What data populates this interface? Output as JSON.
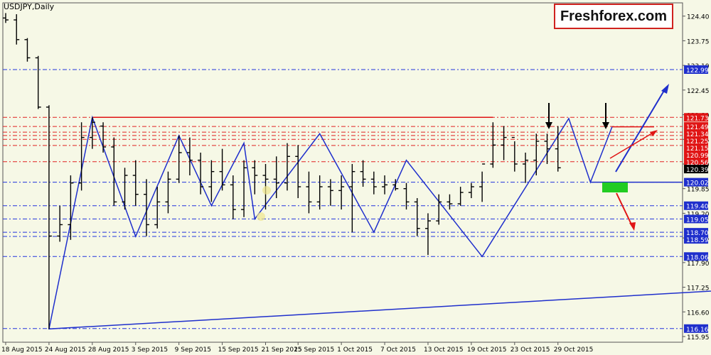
{
  "chart_data": {
    "type": "ohlc",
    "symbol_label": "USDJPY,Daily",
    "watermark_text": "Freshforex.com",
    "ylim": [
      115.8,
      124.75
    ],
    "y_ticks": [
      "124.40",
      "123.75",
      "123.10",
      "122.45",
      "121.80",
      "121.15",
      "120.50",
      "119.85",
      "119.20",
      "118.55",
      "117.90",
      "117.25",
      "116.60",
      "115.95"
    ],
    "x_ticks": [
      "18 Aug 2015",
      "24 Aug 2015",
      "28 Aug 2015",
      "3 Sep 2015",
      "9 Sep 2015",
      "15 Sep 2015",
      "21 Sep 2015",
      "25 Sep 2015",
      "1 Oct 2015",
      "7 Oct 2015",
      "13 Oct 2015",
      "19 Oct 2015",
      "23 Oct 2015",
      "29 Oct 2015"
    ],
    "bars": [
      {
        "o": 124.35,
        "h": 124.48,
        "l": 124.22,
        "c": 124.3
      },
      {
        "o": 124.3,
        "h": 124.45,
        "l": 123.65,
        "c": 123.78
      },
      {
        "o": 123.78,
        "h": 123.82,
        "l": 123.2,
        "c": 123.3
      },
      {
        "o": 123.3,
        "h": 123.35,
        "l": 121.95,
        "c": 122.0
      },
      {
        "o": 122.0,
        "h": 122.05,
        "l": 116.15,
        "c": 118.6
      },
      {
        "o": 118.6,
        "h": 119.4,
        "l": 118.45,
        "c": 118.9
      },
      {
        "o": 118.9,
        "h": 120.2,
        "l": 118.5,
        "c": 120.0
      },
      {
        "o": 120.0,
        "h": 121.6,
        "l": 119.8,
        "c": 121.2
      },
      {
        "o": 121.2,
        "h": 121.73,
        "l": 120.9,
        "c": 121.6
      },
      {
        "o": 121.5,
        "h": 121.6,
        "l": 120.8,
        "c": 120.95
      },
      {
        "o": 120.95,
        "h": 121.2,
        "l": 119.4,
        "c": 119.5
      },
      {
        "o": 119.5,
        "h": 120.4,
        "l": 119.3,
        "c": 120.2
      },
      {
        "o": 120.2,
        "h": 120.6,
        "l": 119.4,
        "c": 119.7
      },
      {
        "o": 119.7,
        "h": 120.1,
        "l": 118.6,
        "c": 118.9
      },
      {
        "o": 118.9,
        "h": 119.9,
        "l": 118.8,
        "c": 119.5
      },
      {
        "o": 119.5,
        "h": 120.3,
        "l": 119.2,
        "c": 120.1
      },
      {
        "o": 120.1,
        "h": 121.25,
        "l": 120.0,
        "c": 120.8
      },
      {
        "o": 120.8,
        "h": 121.2,
        "l": 120.2,
        "c": 120.6
      },
      {
        "o": 120.6,
        "h": 120.8,
        "l": 119.7,
        "c": 119.9
      },
      {
        "o": 119.9,
        "h": 120.6,
        "l": 119.5,
        "c": 120.3
      },
      {
        "o": 120.3,
        "h": 120.9,
        "l": 119.8,
        "c": 119.95
      },
      {
        "o": 119.95,
        "h": 120.2,
        "l": 119.05,
        "c": 119.3
      },
      {
        "o": 119.3,
        "h": 120.6,
        "l": 119.1,
        "c": 120.4
      },
      {
        "o": 120.4,
        "h": 120.6,
        "l": 119.7,
        "c": 120.2
      },
      {
        "o": 120.2,
        "h": 120.5,
        "l": 119.3,
        "c": 120.1
      },
      {
        "o": 120.1,
        "h": 120.7,
        "l": 119.6,
        "c": 120.0
      },
      {
        "o": 120.0,
        "h": 121.05,
        "l": 119.8,
        "c": 120.7
      },
      {
        "o": 120.7,
        "h": 121.0,
        "l": 119.6,
        "c": 119.9
      },
      {
        "o": 119.9,
        "h": 120.3,
        "l": 119.2,
        "c": 119.5
      },
      {
        "o": 119.5,
        "h": 120.2,
        "l": 119.3,
        "c": 119.9
      },
      {
        "o": 119.9,
        "h": 120.1,
        "l": 119.4,
        "c": 119.8
      },
      {
        "o": 119.8,
        "h": 120.2,
        "l": 119.3,
        "c": 119.9
      },
      {
        "o": 119.9,
        "h": 120.5,
        "l": 118.7,
        "c": 120.3
      },
      {
        "o": 120.3,
        "h": 120.6,
        "l": 119.9,
        "c": 120.1
      },
      {
        "o": 120.1,
        "h": 120.3,
        "l": 119.7,
        "c": 119.9
      },
      {
        "o": 119.9,
        "h": 120.2,
        "l": 119.7,
        "c": 119.95
      },
      {
        "o": 119.95,
        "h": 120.1,
        "l": 119.8,
        "c": 119.85
      },
      {
        "o": 119.85,
        "h": 120.0,
        "l": 119.3,
        "c": 119.5
      },
      {
        "o": 119.5,
        "h": 119.6,
        "l": 118.6,
        "c": 118.8
      },
      {
        "o": 118.8,
        "h": 119.2,
        "l": 118.1,
        "c": 119.0
      },
      {
        "o": 119.0,
        "h": 119.7,
        "l": 118.9,
        "c": 119.5
      },
      {
        "o": 119.5,
        "h": 119.7,
        "l": 119.3,
        "c": 119.45
      },
      {
        "o": 119.45,
        "h": 119.9,
        "l": 119.4,
        "c": 119.75
      },
      {
        "o": 119.75,
        "h": 120.0,
        "l": 119.6,
        "c": 119.9
      },
      {
        "o": 119.9,
        "h": 120.3,
        "l": 119.5,
        "c": 120.5
      },
      {
        "o": 120.5,
        "h": 121.6,
        "l": 120.4,
        "c": 121.0
      },
      {
        "o": 121.0,
        "h": 121.5,
        "l": 120.6,
        "c": 121.2
      },
      {
        "o": 121.2,
        "h": 121.1,
        "l": 120.3,
        "c": 120.5
      },
      {
        "o": 120.5,
        "h": 120.8,
        "l": 120.0,
        "c": 120.6
      },
      {
        "o": 120.6,
        "h": 121.3,
        "l": 120.2,
        "c": 121.1
      },
      {
        "o": 121.1,
        "h": 121.3,
        "l": 120.5,
        "c": 120.9
      },
      {
        "o": 120.9,
        "h": 121.5,
        "l": 120.3,
        "c": 120.4
      }
    ],
    "zigzag": [
      [
        120.5,
        118.05
      ],
      [
        4,
        116.15
      ],
      [
        8,
        121.73
      ],
      [
        12,
        118.59
      ],
      [
        16,
        121.25
      ],
      [
        19,
        119.4
      ],
      [
        22,
        121.05
      ],
      [
        23,
        119.05
      ],
      [
        29,
        121.3
      ],
      [
        34,
        118.7
      ],
      [
        37,
        120.6
      ],
      [
        44,
        118.06
      ],
      [
        52,
        121.7
      ],
      [
        54,
        120.02
      ],
      [
        56,
        121.48
      ]
    ],
    "levels": [
      {
        "value": "122.99",
        "color": "#2233DD",
        "style": "dashdot",
        "label_bg": "#1F2FCC"
      },
      {
        "value": "121.73",
        "color": "#E02020",
        "style": "dashdot",
        "label_bg": "#E01515"
      },
      {
        "value": "121.49",
        "color": "#E02020",
        "style": "dashdot",
        "label_bg": "#E01515"
      },
      {
        "value": "121.34",
        "color": "#E02020",
        "style": "dashdot",
        "label_bg": "#E01515"
      },
      {
        "value": "121.25",
        "color": "#E02020",
        "style": "dashdot",
        "label_bg": "#E01515"
      },
      {
        "value": "121.15",
        "color": "#E02020",
        "style": "dashdot",
        "label_bg": "#E01515"
      },
      {
        "value": "120.99",
        "color": "#E02020",
        "style": "dashdot",
        "label_bg": "#E01515"
      },
      {
        "value": "120.56",
        "color": "#E02020",
        "style": "dashdot",
        "label_bg": "#E01515"
      },
      {
        "value": "120.39",
        "color": "#000000",
        "style": "none",
        "label_bg": "#000000"
      },
      {
        "value": "120.02",
        "color": "#2233DD",
        "style": "dashdot",
        "label_bg": "#1F2FCC"
      },
      {
        "value": "119.40",
        "color": "#2233DD",
        "style": "dashdot",
        "label_bg": "#1F2FCC"
      },
      {
        "value": "119.05",
        "color": "#2233DD",
        "style": "dashdot",
        "label_bg": "#1F2FCC"
      },
      {
        "value": "118.70",
        "color": "#2233DD",
        "style": "dashdot",
        "label_bg": "#1F2FCC"
      },
      {
        "value": "118.59",
        "color": "#2233DD",
        "style": "dashdot",
        "label_bg": "#1F2FCC"
      },
      {
        "value": "118.06",
        "color": "#2233DD",
        "style": "dashdot",
        "label_bg": "#1F2FCC"
      },
      {
        "value": "116.16",
        "color": "#2233DD",
        "style": "dashdot",
        "label_bg": "#1F2FCC"
      }
    ],
    "resistance_line": {
      "value": 121.73,
      "x_from": 8,
      "x_to": 45
    },
    "resistance_line2": {
      "value": 121.48,
      "x_from": 56,
      "x_to": 58
    },
    "support_line": {
      "value": 120.02,
      "x_from": 54,
      "x_to": 62
    },
    "colors": {
      "bars": "#000000",
      "zigzag": "#1F2FCC",
      "resistance": "#E01515",
      "support": "#1F2FCC",
      "up_arrow": "#1F2FCC",
      "down_arrow": "#E01515",
      "target_box": "#22CC22",
      "background": "#F6F8E6"
    }
  }
}
